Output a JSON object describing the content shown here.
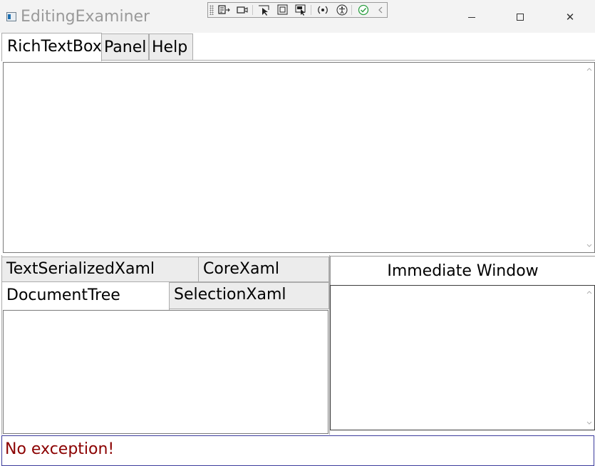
{
  "window": {
    "title": "EditingExaminer",
    "min_label": "",
    "max_label": "",
    "close_label": "✕"
  },
  "dev_toolbar": {
    "icons": [
      "go-to-live-visual-tree-icon",
      "record-icon",
      "select-element-icon",
      "display-layout-adorners-icon",
      "track-focused-element-icon",
      "binding-failures-icon",
      "accessibility-icon",
      "hot-reload-status-icon",
      "collapse-chevron-icon"
    ]
  },
  "top_tabs": [
    {
      "label": "RichTextBox",
      "selected": true
    },
    {
      "label": "Panel",
      "selected": false
    },
    {
      "label": "Help",
      "selected": false
    }
  ],
  "lower_tabs": [
    {
      "label": "TextSerializedXaml",
      "selected": false
    },
    {
      "label": "CoreXaml",
      "selected": false
    },
    {
      "label": "DocumentTree",
      "selected": true
    },
    {
      "label": "SelectionXaml",
      "selected": false
    }
  ],
  "immediate_window": {
    "header": "Immediate Window",
    "content": ""
  },
  "status": {
    "message": "No exception!"
  },
  "colors": {
    "status_text": "#8b0000",
    "status_border": "#3c3c9c",
    "hot_reload_ok": "#2ea043"
  }
}
